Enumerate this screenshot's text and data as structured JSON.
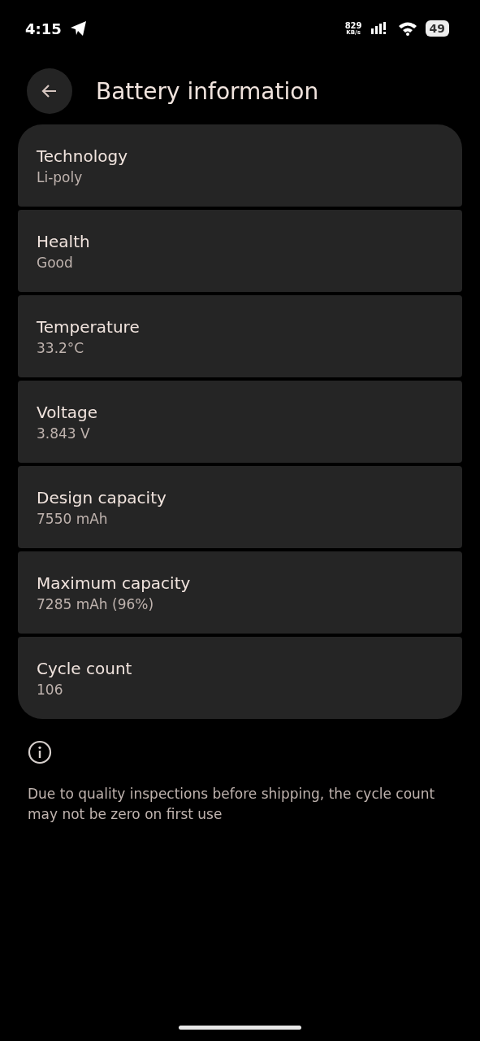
{
  "status_bar": {
    "time": "4:15",
    "net_speed": "829",
    "net_unit": "KB/s",
    "battery": "49"
  },
  "header": {
    "title": "Battery information"
  },
  "items": [
    {
      "title": "Technology",
      "value": "Li-poly"
    },
    {
      "title": "Health",
      "value": "Good"
    },
    {
      "title": "Temperature",
      "value": "33.2°C"
    },
    {
      "title": "Voltage",
      "value": "3.843 V"
    },
    {
      "title": "Design capacity",
      "value": "7550 mAh"
    },
    {
      "title": "Maximum capacity",
      "value": "7285 mAh (96%)"
    },
    {
      "title": "Cycle count",
      "value": "106"
    }
  ],
  "note": "Due to quality inspections before shipping, the cycle count may not be zero on first use"
}
